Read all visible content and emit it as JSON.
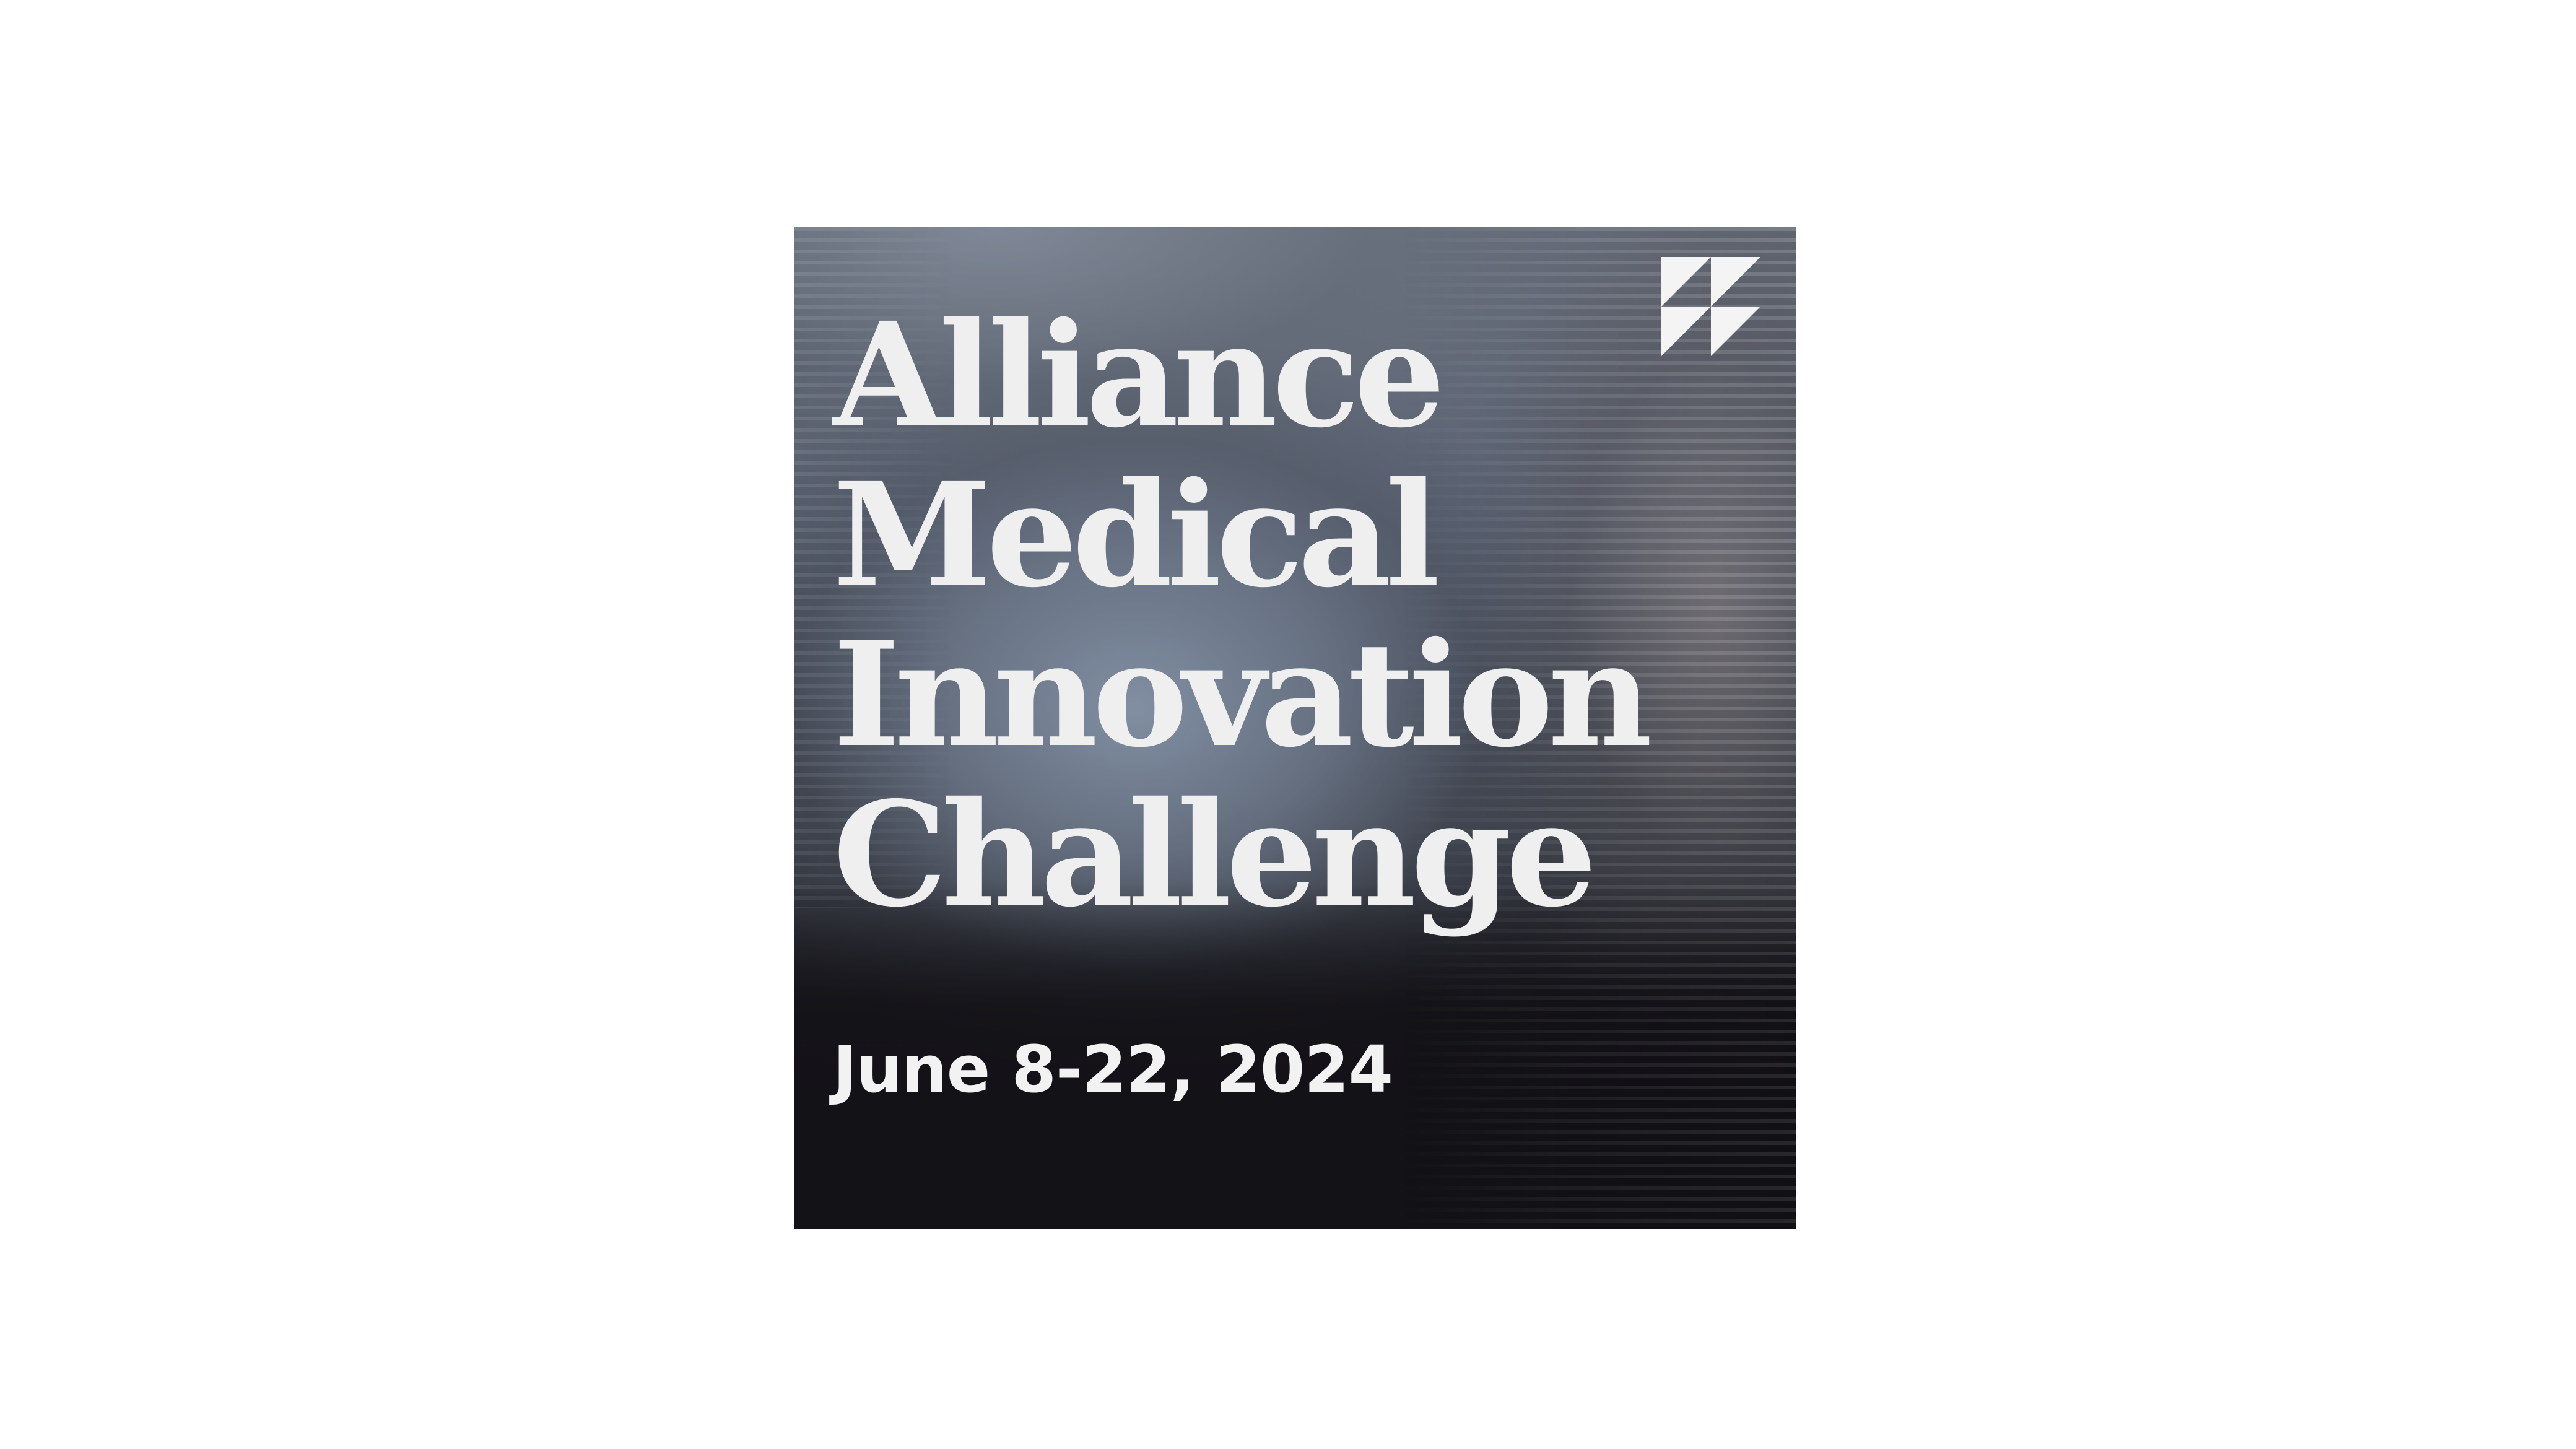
{
  "poster": {
    "title_lines": [
      "Alliance",
      "Medical",
      "Innovation",
      "Challenge"
    ],
    "date": "June 8-22, 2024",
    "logo_icon": "geometric-triangles-logo-icon"
  },
  "colors": {
    "page_background": "#ffffff",
    "text": "#efefef",
    "poster_dark": "#131217",
    "poster_blue_gray": "#6c7380"
  }
}
